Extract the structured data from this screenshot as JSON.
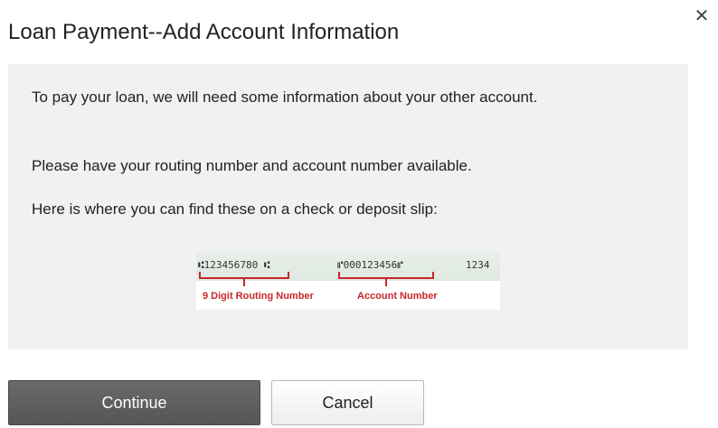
{
  "dialog": {
    "title": "Loan Payment--Add Account Information",
    "close_glyph": "✕",
    "close_icon": "close-icon"
  },
  "info": {
    "paragraph1": "To pay your loan, we will need some information about your other account.",
    "paragraph2": "Please have your routing number and account number available.",
    "paragraph3": "Here is where you can find these on a check or deposit slip:"
  },
  "check_diagram": {
    "micr_routing": "⑆123456780 ⑆",
    "micr_account": "⑈000123456⑈",
    "micr_check": "1234",
    "routing_label": "9 Digit Routing Number",
    "account_label": "Account Number",
    "label_color": "#c8262c"
  },
  "buttons": {
    "continue_label": "Continue",
    "cancel_label": "Cancel"
  }
}
